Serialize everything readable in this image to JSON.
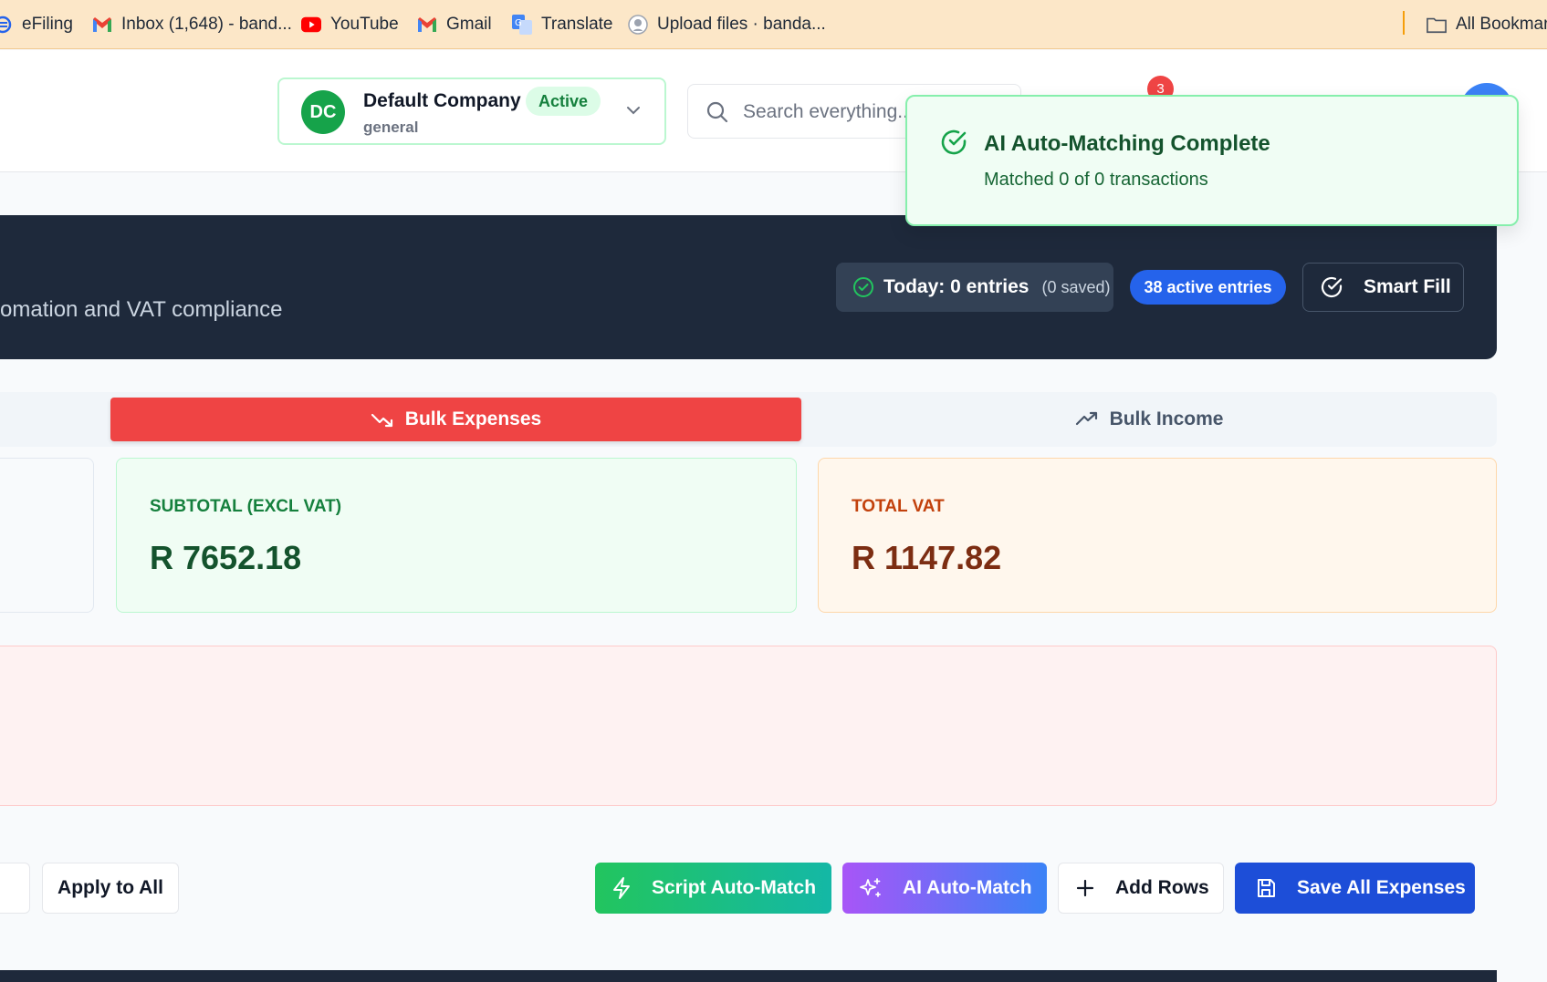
{
  "bookmarks": {
    "items": [
      {
        "label": "eFiling",
        "icon": "efiling-icon"
      },
      {
        "label": "Inbox (1,648) - band...",
        "icon": "gmail-icon"
      },
      {
        "label": "YouTube",
        "icon": "youtube-icon"
      },
      {
        "label": "Gmail",
        "icon": "gmail-icon"
      },
      {
        "label": "Translate",
        "icon": "google-translate-icon"
      },
      {
        "label": "Upload files · banda...",
        "icon": "github-icon"
      }
    ],
    "all_bookmarks": "All Bookmar"
  },
  "header": {
    "company": {
      "initials": "DC",
      "name": "Default Company",
      "status": "Active",
      "category": "general"
    },
    "search": {
      "placeholder": "Search everything..."
    },
    "notification_count": "3"
  },
  "toast": {
    "title": "AI Auto-Matching Complete",
    "message": "Matched 0 of 0 transactions"
  },
  "hero": {
    "description": "omation and VAT compliance",
    "today_label": "Today: 0 entries",
    "today_saved": "(0 saved)",
    "active_entries": "38 active entries",
    "smart_fill": "Smart Fill"
  },
  "tabs": {
    "expenses": "Bulk Expenses",
    "income": "Bulk Income"
  },
  "summary": {
    "subtotal_label": "SUBTOTAL (EXCL VAT)",
    "subtotal_value": "R 7652.18",
    "vat_label": "TOTAL VAT",
    "vat_value": "R 1147.82"
  },
  "actions": {
    "apply_all": "Apply to All",
    "script_auto_match": "Script Auto-Match",
    "ai_auto_match": "AI Auto-Match",
    "add_rows": "Add Rows",
    "save_all": "Save All Expenses"
  },
  "colors": {
    "expense_tab": "#ef4444",
    "hero_bg": "#1e293b",
    "active_pill": "#2563eb",
    "save_button": "#1d4ed8",
    "toast_bg": "#f0fdf4"
  }
}
